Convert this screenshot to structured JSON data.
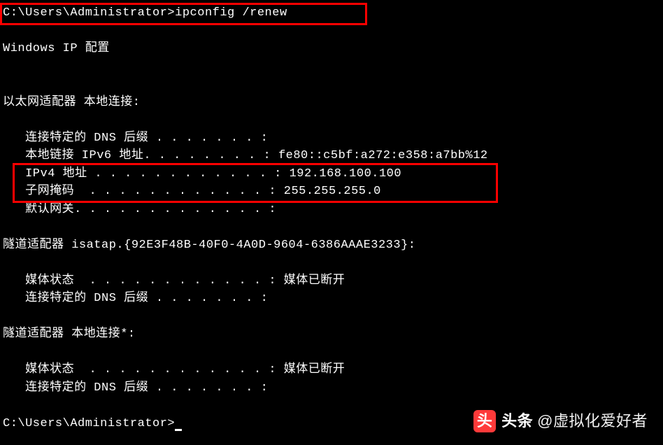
{
  "prompt1": "C:\\Users\\Administrator>ipconfig /renew",
  "header": "Windows IP 配置",
  "adapter1": {
    "title": "以太网适配器 本地连接:",
    "dns_suffix_label": "   连接特定的 DNS 后缀 . . . . . . . :",
    "ipv6_label": "   本地链接 IPv6 地址. . . . . . . . : ",
    "ipv6_value": "fe80::c5bf:a272:e358:a7bb%12",
    "ipv4_label": "   IPv4 地址 . . . . . . . . . . . . : ",
    "ipv4_value": "192.168.100.100",
    "subnet_label": "   子网掩码  . . . . . . . . . . . . : ",
    "subnet_value": "255.255.255.0",
    "gateway_label": "   默认网关. . . . . . . . . . . . . :"
  },
  "adapter2": {
    "title": "隧道适配器 isatap.{92E3F48B-40F0-4A0D-9604-6386AAAE3233}:",
    "media_label": "   媒体状态  . . . . . . . . . . . . : ",
    "media_value": "媒体已断开",
    "dns_suffix_label": "   连接特定的 DNS 后缀 . . . . . . . :"
  },
  "adapter3": {
    "title": "隧道适配器 本地连接*:",
    "media_label": "   媒体状态  . . . . . . . . . . . . : ",
    "media_value": "媒体已断开",
    "dns_suffix_label": "   连接特定的 DNS 后缀 . . . . . . . :"
  },
  "prompt2": "C:\\Users\\Administrator>",
  "watermark": {
    "brand": "头条",
    "user": "@虚拟化爱好者"
  }
}
